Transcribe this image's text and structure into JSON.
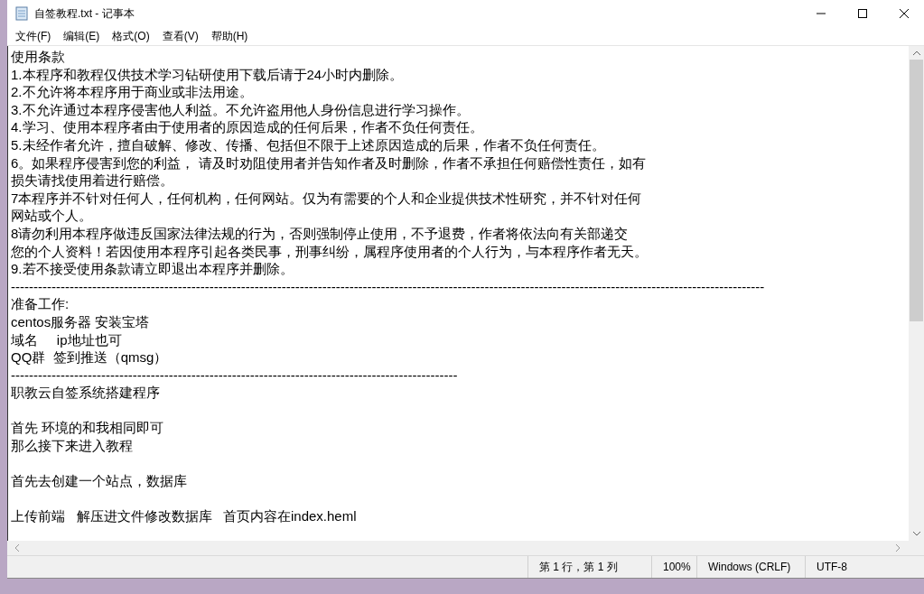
{
  "window": {
    "title": "自签教程.txt - 记事本"
  },
  "menu": [
    "文件(F)",
    "编辑(E)",
    "格式(O)",
    "查看(V)",
    "帮助(H)"
  ],
  "editor": {
    "blocks": [
      {
        "lines": [
          "使用条款",
          "1.本程序和教程仅供技术学习钻研使用下载后请于24小时内删除。",
          "2.不允许将本程序用于商业或非法用途。",
          "3.不允许通过本程序侵害他人利益。不允许盗用他人身份信息进行学习操作。",
          "4.学习、使用本程序者由于使用者的原因造成的任何后果，作者不负任何责任。",
          "5.未经作者允许，擅自破解、修改、传播、包括但不限于上述原因造成的后果，作者不负任何责任。",
          "6。如果程序侵害到您的利益， 请及时劝阻使用者并告知作者及时删除，作者不承担任何赔偿性责任，如有",
          "损失请找使用着进行赔偿。",
          "7本程序并不针对任何人，任何机构，任何网站。仅为有需要的个人和企业提供技术性研究，并不针对任何",
          "网站或个人。",
          "8请勿利用本程序做违反国家法律法规的行为，否则强制停止使用，不予退费，作者将依法向有关部递交",
          "您的个人资料！若因使用本程序引起各类民事，刑事纠纷，属程序使用者的个人行为，与本程序作者无天。",
          "9.若不接受使用条款请立即退出本程序并删除。",
          "-----------------------------------------------------------------------------------------------------------------------------------------------------------------------",
          "准备工作:",
          "centos服务器 安装宝塔",
          "域名     ip地址也可",
          "QQ群  签到推送（qmsg）",
          "---------------------------------------------------------------------------------------------------",
          "职教云自签系统搭建程序"
        ]
      },
      {
        "lines": [
          "首先 环境的和我相同即可",
          "那么接下来进入教程"
        ]
      },
      {
        "lines": [
          "首先去创建一个站点，数据库"
        ]
      },
      {
        "lines": [
          "上传前端   解压进文件修改数据库   首页内容在index.heml"
        ]
      }
    ]
  },
  "status_bar": {
    "position": "第 1 行，第 1 列",
    "zoom": "100%",
    "line_ending": "Windows (CRLF)",
    "encoding": "UTF-8"
  }
}
